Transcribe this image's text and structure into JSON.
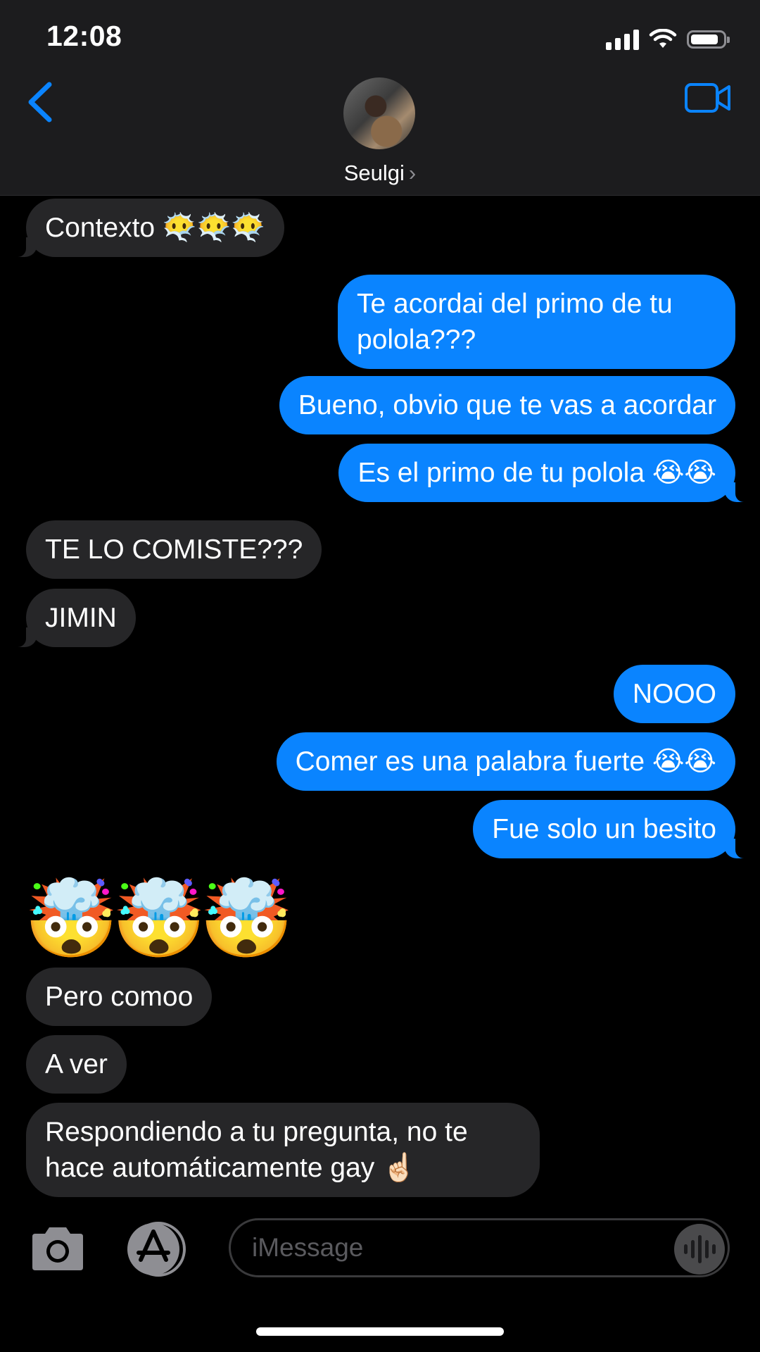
{
  "status_bar": {
    "time": "12:08"
  },
  "header": {
    "contact_name": "Seulgi"
  },
  "messages": [
    {
      "from": "them",
      "text": "Contexto 😶‍🌫️😶‍🌫️😶‍🌫️"
    },
    {
      "from": "me",
      "text": "Te acordai del primo de tu pololа???"
    },
    {
      "from": "me",
      "text": "Bueno, obvio que te vas a acordar"
    },
    {
      "from": "me",
      "text": "Es el primo de tu polola 😭😭"
    },
    {
      "from": "them",
      "text": "TE LO COMISTE???"
    },
    {
      "from": "them",
      "text": "JIMIN"
    },
    {
      "from": "me",
      "text": "NOOO"
    },
    {
      "from": "me",
      "text": "Comer es una palabra fuerte 😭😭"
    },
    {
      "from": "me",
      "text": "Fue solo un besito"
    },
    {
      "from": "them",
      "text": "🤯🤯🤯"
    },
    {
      "from": "them",
      "text": "Pero comoo"
    },
    {
      "from": "them",
      "text": "A ver"
    },
    {
      "from": "them",
      "text": "Respondiendo a tu pregunta, no te hace automáticamente gay ☝🏻"
    }
  ],
  "composer": {
    "placeholder": "iMessage"
  },
  "colors": {
    "outgoing": "#0a84ff",
    "incoming": "#262628",
    "accent": "#0a84ff"
  },
  "icons": {
    "back": "chevron-left-icon",
    "video": "video-camera-icon",
    "camera": "camera-icon",
    "apps": "app-store-icon",
    "audio": "audio-waveform-icon"
  }
}
